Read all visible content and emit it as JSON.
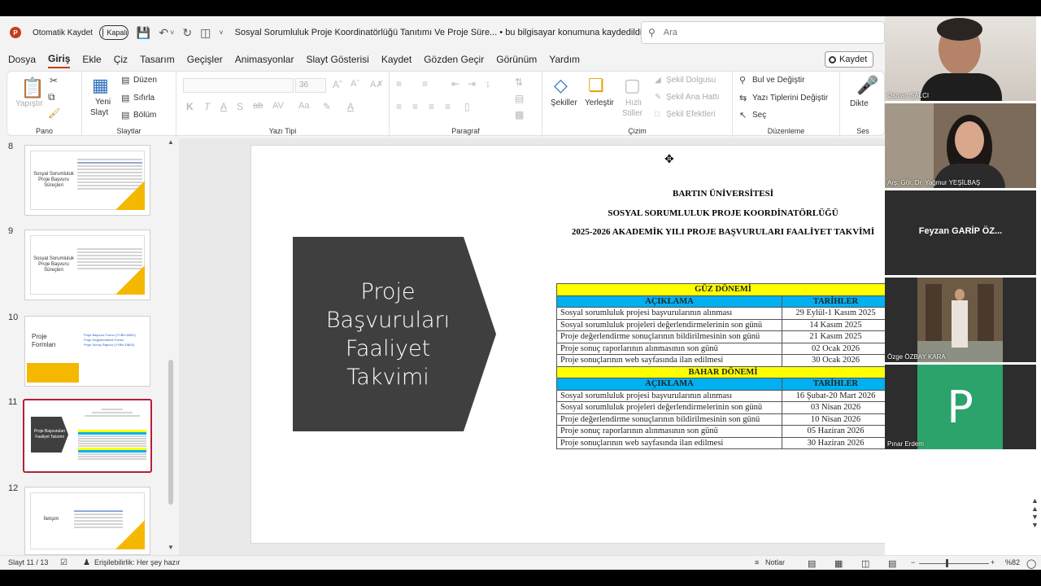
{
  "titlebar": {
    "autosave_label": "Otomatik Kaydet",
    "autosave_state": "Kapalı",
    "doc_title": "Sosyal Sorumluluk Proje Koordinatörlüğü Tanıtımı Ve Proje Süre... • bu bilgisayar konumuna kaydedildi",
    "search_placeholder": "Ara"
  },
  "menu": {
    "items": [
      "Dosya",
      "Giriş",
      "Ekle",
      "Çiz",
      "Tasarım",
      "Geçişler",
      "Animasyonlar",
      "Slayt Gösterisi",
      "Kaydet",
      "Gözden Geçir",
      "Görünüm",
      "Yardım"
    ],
    "record_label": "Kaydet"
  },
  "ribbon": {
    "paste": "Yapıştır",
    "clipboard_group": "Pano",
    "new_slide": "Yeni",
    "new_slide2": "Slayt",
    "layout": "Düzen",
    "reset": "Sıfırla",
    "section": "Bölüm",
    "slides_group": "Slaytlar",
    "font_size": "36",
    "font_group": "Yazı Tipi",
    "paragraph_group": "Paragraf",
    "shapes": "Şekiller",
    "arrange": "Yerleştir",
    "quick_styles": "Hızlı",
    "quick_styles2": "Stiller",
    "shape_fill": "Şekil Dolgusu",
    "shape_outline": "Şekil Ana Hattı",
    "shape_effects": "Şekil Efektleri",
    "drawing_group": "Çizim",
    "find_replace": "Bul ve Değiştir",
    "replace_fonts": "Yazı Tiplerini Değiştir",
    "select": "Seç",
    "editing_group": "Düzenleme",
    "dictate": "Dikte",
    "voice_group": "Ses"
  },
  "thumbnails": [
    {
      "num": "8",
      "title": "Sosyal Sorumluluk Proje Başvuru Süreçleri"
    },
    {
      "num": "9",
      "title": "Sosyal Sorumluluk Proje Başvuru Süreçleri"
    },
    {
      "num": "10",
      "title": "Proje Formları",
      "links": [
        "Proje Başvuru Formu (YYBH-DB01)",
        "Proje Değerlendirme Formu",
        "Proje Sonuç Raporu (YYBH-DB03)"
      ]
    },
    {
      "num": "11",
      "title": "Proje Başvuruları Faaliyet Takvimi"
    },
    {
      "num": "12",
      "title": "İletişim"
    }
  ],
  "slide": {
    "pentagon_text": [
      "Proje",
      "Başvuruları",
      "Faaliyet",
      "Takvimi"
    ],
    "header1": "BARTIN ÜNİVERSİTESİ",
    "header2": "SOSYAL SORUMLULUK PROJE KOORDİNATÖRLÜĞÜ",
    "header3": "2025-2026 AKADEMİK YILI PROJE BAŞVURULARI FAALİYET TAKVİMİ",
    "col_desc": "AÇIKLAMA",
    "col_date": "TARİHLER",
    "fall": {
      "title": "GÜZ DÖNEMİ",
      "rows": [
        {
          "desc": "Sosyal sorumluluk projesi başvurularının alınması",
          "date": "29 Eylül-1 Kasım 2025"
        },
        {
          "desc": "Sosyal sorumluluk projeleri değerlendirmelerinin son günü",
          "date": "14 Kasım 2025"
        },
        {
          "desc": "Proje değerlendirme sonuçlarının bildirilmesinin son günü",
          "date": "21 Kasım 2025"
        },
        {
          "desc": "Proje sonuç raporlarının alınmasının son günü",
          "date": "02 Ocak 2026"
        },
        {
          "desc": "Proje sonuçlarının web sayfasında ilan edilmesi",
          "date": "30 Ocak 2026"
        }
      ]
    },
    "spring": {
      "title": "BAHAR DÖNEMİ",
      "rows": [
        {
          "desc": "Sosyal sorumluluk projesi başvurularının alınması",
          "date": "16 Şubat-20 Mart 2026"
        },
        {
          "desc": "Sosyal sorumluluk projeleri değerlendirmelerinin son günü",
          "date": "03 Nisan 2026"
        },
        {
          "desc": "Proje değerlendirme sonuçlarının bildirilmesinin son günü",
          "date": "10 Nisan 2026"
        },
        {
          "desc": "Proje sonuç raporlarının alınmasının son günü",
          "date": "05 Haziran 2026"
        },
        {
          "desc": "Proje sonuçlarının web sayfasında ilan edilmesi",
          "date": "30 Haziran 2026"
        }
      ]
    }
  },
  "participants": [
    {
      "name": "Osman ŞALCI"
    },
    {
      "name": "Arş. Gör. Dr. Yağmur YEŞİLBAŞ"
    },
    {
      "name": "Feyzan GARİP ÖZ..."
    },
    {
      "name": "Özge ÖZBAY KARA"
    },
    {
      "name": "Pınar Erdem",
      "initial": "P"
    }
  ],
  "status": {
    "slide_count": "Slayt 11 / 13",
    "accessibility": "Erişilebilirlik: Her şey hazır",
    "notes": "Notlar",
    "zoom": "%82"
  },
  "colors": {
    "accent": "#c43e1c",
    "selected_thumb": "#b22234",
    "season_bar": "#ffff00",
    "col_header": "#00b0f0",
    "pentagon": "#3f3f3f",
    "thumb_accent": "#f5b800",
    "avatar_green": "#2ba36b"
  }
}
